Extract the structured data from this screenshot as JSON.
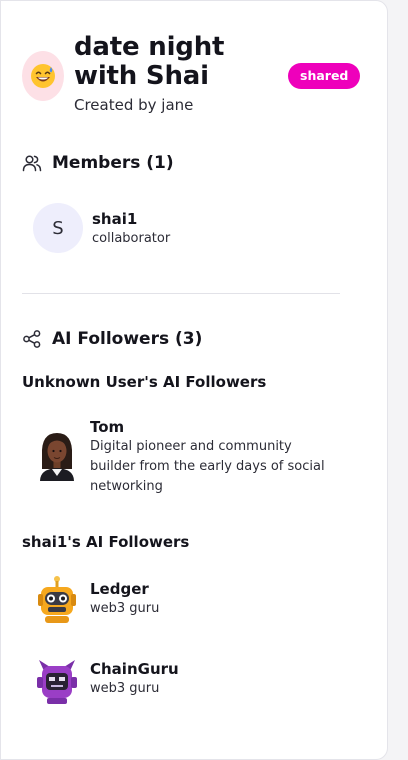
{
  "board": {
    "title": "date night with Shai",
    "created_by": "Created by jane",
    "badge": "shared",
    "badge_color": "#ee00bb",
    "icon": "grinning-sweat-emoji-icon"
  },
  "members": {
    "heading": "Members (1)",
    "icon": "users-icon",
    "items": [
      {
        "initial": "S",
        "name": "shai1",
        "role": "collaborator"
      }
    ]
  },
  "ai_followers": {
    "heading": "AI Followers (3)",
    "icon": "share-icon",
    "groups": [
      {
        "title": "Unknown User's AI Followers",
        "items": [
          {
            "name": "Tom",
            "description": "Digital pioneer and community builder from the early days of social networking",
            "icon": "person-avatar-icon"
          }
        ]
      },
      {
        "title": "shai1's AI Followers",
        "items": [
          {
            "name": "Ledger",
            "description": "web3 guru",
            "icon": "orange-robot-icon"
          },
          {
            "name": "ChainGuru",
            "description": "web3 guru",
            "icon": "purple-robot-icon"
          }
        ]
      }
    ]
  }
}
